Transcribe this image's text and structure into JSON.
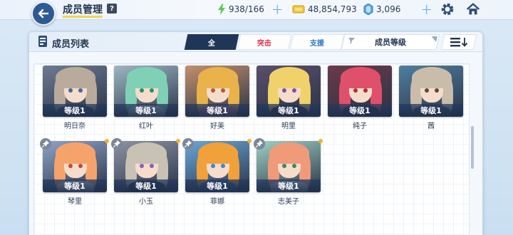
{
  "header": {
    "title": "成员管理",
    "help": "?",
    "ap": "938/166",
    "credits": "48,854,793",
    "gems": "3,096"
  },
  "panel": {
    "title": "成员列表",
    "tabs": [
      {
        "label": "全"
      },
      {
        "label": "突击"
      },
      {
        "label": "支援"
      }
    ],
    "sort_label": "成员等级"
  },
  "members": [
    {
      "name": "明日奈",
      "level": "等级1",
      "pinned": false,
      "hair": "#b9ab9b",
      "eyes": "#3d6aa8",
      "outfit": "#3a4455",
      "bg": "#6d7a93"
    },
    {
      "name": "红叶",
      "level": "等级1",
      "pinned": false,
      "hair": "#7fd0b5",
      "eyes": "#2f8c6a",
      "outfit": "#e8eef4",
      "bg": "#9fb6c4"
    },
    {
      "name": "好美",
      "level": "等级1",
      "pinned": false,
      "hair": "#e9b24a",
      "eyes": "#b35a3a",
      "outfit": "#d77b9a",
      "bg": "#c38f6d"
    },
    {
      "name": "明里",
      "level": "等级1",
      "pinned": false,
      "hair": "#f1d26a",
      "eyes": "#7c4fb3",
      "outfit": "#2a2430",
      "bg": "#5a4f6b"
    },
    {
      "name": "纯子",
      "level": "等级1",
      "pinned": false,
      "hair": "#e0506a",
      "eyes": "#b9283a",
      "outfit": "#2b2530",
      "bg": "#6a3a4a"
    },
    {
      "name": "茜",
      "level": "等级1",
      "pinned": false,
      "hair": "#c9bca9",
      "eyes": "#5b4a3a",
      "outfit": "#3c4658",
      "bg": "#4f7fa0"
    },
    {
      "name": "琴里",
      "level": "等级1",
      "pinned": true,
      "hair": "#f5a36a",
      "eyes": "#c04a3a",
      "outfit": "#f2f2f4",
      "bg": "#8fa3c8"
    },
    {
      "name": "小玉",
      "level": "等级1",
      "pinned": true,
      "hair": "#c7c2b3",
      "eyes": "#8a5fc0",
      "outfit": "#2a2b31",
      "bg": "#8c93a3"
    },
    {
      "name": "菲娜",
      "level": "等级1",
      "pinned": true,
      "hair": "#f0a13a",
      "eyes": "#3a8ad0",
      "outfit": "#3d5fa8",
      "bg": "#6aa6d8"
    },
    {
      "name": "志美子",
      "level": "等级1",
      "pinned": true,
      "hair": "#f09a7a",
      "eyes": "#3e8a62",
      "outfit": "#e6eef0",
      "bg": "#9ed1c6"
    }
  ]
}
